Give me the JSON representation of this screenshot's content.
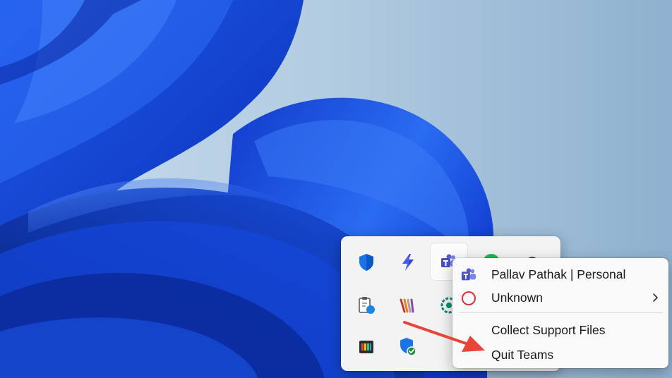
{
  "tray": {
    "icons": [
      {
        "name": "windows-security-icon"
      },
      {
        "name": "power-automate-icon"
      },
      {
        "name": "teams-icon",
        "selected": true
      },
      {
        "name": "spotify-icon"
      },
      {
        "name": "hidden-app-icon"
      },
      {
        "name": "clipboard-sync-icon"
      },
      {
        "name": "stripes-app-icon"
      },
      {
        "name": "green-circle-app-icon"
      },
      {
        "name": "color-bars-app-icon"
      },
      {
        "name": "security-check-icon"
      }
    ]
  },
  "context_menu": {
    "account_label": "Pallav Pathak | Personal",
    "status_label": "Unknown",
    "collect_support_label": "Collect Support Files",
    "quit_label": "Quit Teams"
  },
  "colors": {
    "teams_purple": "#5b5fc7",
    "status_ring": "#d13438",
    "annotation_arrow": "#e8443a"
  }
}
